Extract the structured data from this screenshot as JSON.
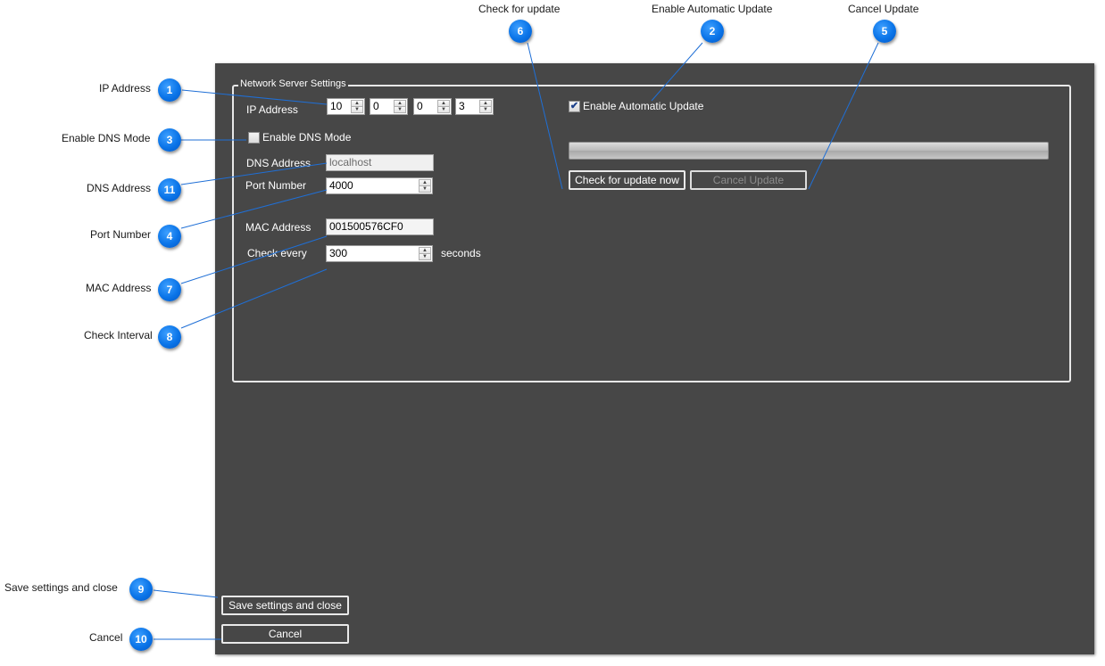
{
  "callouts": [
    {
      "number": "1",
      "label": "IP Address"
    },
    {
      "number": "2",
      "label": "Enable Automatic Update"
    },
    {
      "number": "3",
      "label": "Enable DNS Mode"
    },
    {
      "number": "4",
      "label": "Port Number"
    },
    {
      "number": "5",
      "label": "Cancel Update"
    },
    {
      "number": "6",
      "label": "Check for update"
    },
    {
      "number": "7",
      "label": "MAC Address"
    },
    {
      "number": "8",
      "label": "Check Interval"
    },
    {
      "number": "9",
      "label": "Save settings and close"
    },
    {
      "number": "10",
      "label": "Cancel"
    },
    {
      "number": "11",
      "label": "DNS Address"
    }
  ],
  "dialog": {
    "group_title": "Network Server Settings",
    "ip": {
      "label": "IP Address",
      "octets": [
        "10",
        "0",
        "0",
        "3"
      ]
    },
    "dns_mode": {
      "label": "Enable DNS Mode",
      "checked": false
    },
    "dns_address": {
      "label": "DNS Address",
      "value": "localhost"
    },
    "port": {
      "label": "Port Number",
      "value": "4000"
    },
    "mac": {
      "label": "MAC Address",
      "value": "001500576CF0"
    },
    "interval": {
      "label": "Check every",
      "value": "300",
      "unit": "seconds"
    },
    "auto_update": {
      "label": "Enable Automatic Update",
      "checked": true,
      "check_mark": "✔"
    },
    "update_progress": 0,
    "check_now_label": "Check for update now",
    "cancel_update_label": "Cancel Update",
    "save_label": "Save settings and close",
    "cancel_label": "Cancel"
  },
  "colors": {
    "dialog_bg": "#474747",
    "badge": "#0a74e8",
    "leader_line": "#1f6fd6"
  }
}
